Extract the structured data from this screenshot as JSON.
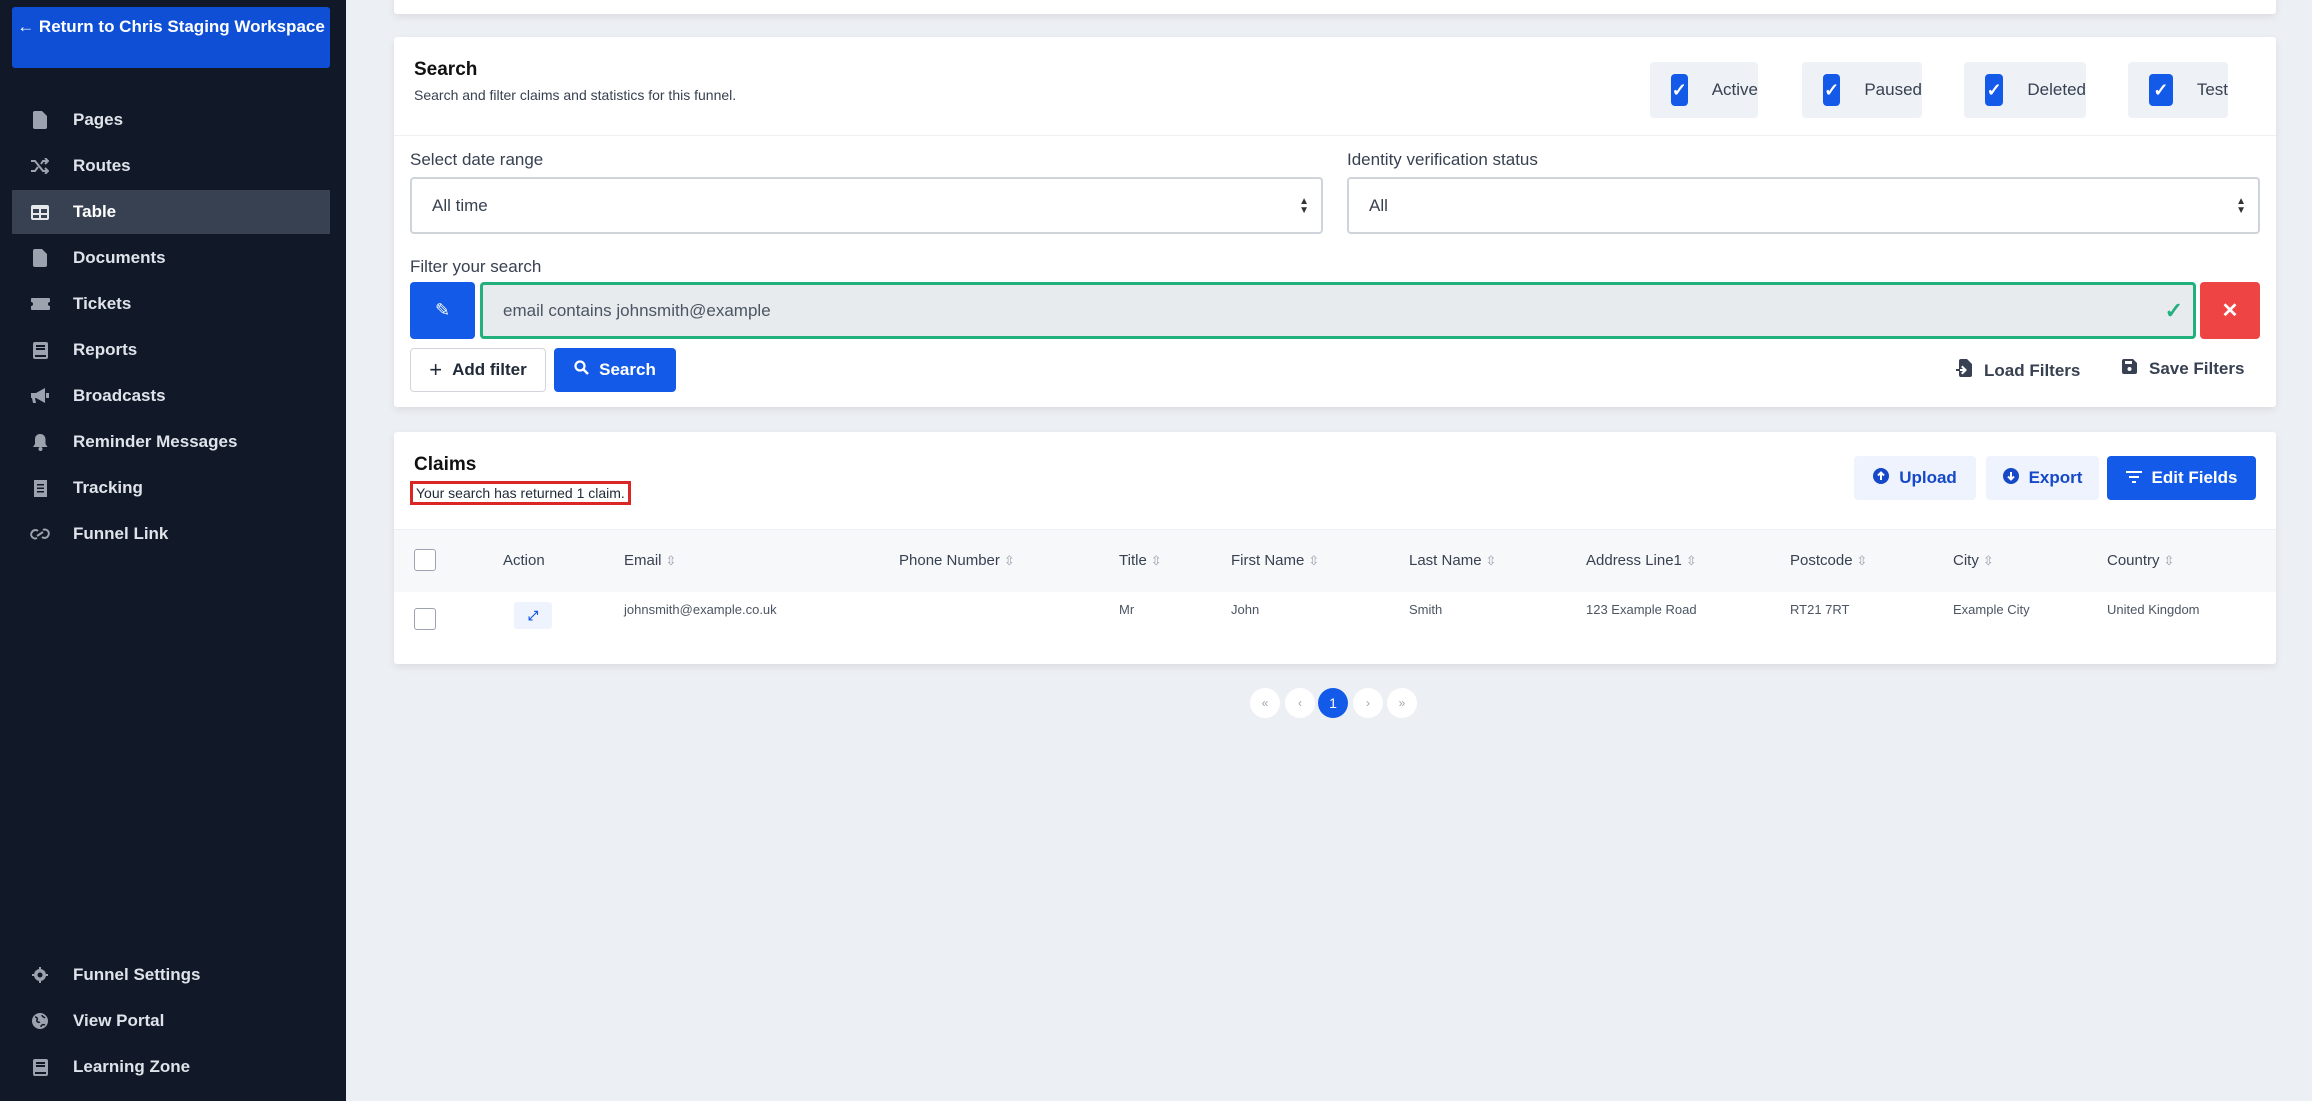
{
  "sidebar": {
    "return_label": "← Return to Chris Staging Workspace",
    "items": [
      {
        "label": "Pages",
        "icon": "file-icon"
      },
      {
        "label": "Routes",
        "icon": "shuffle-icon"
      },
      {
        "label": "Table",
        "icon": "table-icon",
        "active": true
      },
      {
        "label": "Documents",
        "icon": "file-icon"
      },
      {
        "label": "Tickets",
        "icon": "ticket-icon"
      },
      {
        "label": "Reports",
        "icon": "book-icon"
      },
      {
        "label": "Broadcasts",
        "icon": "megaphone-icon"
      },
      {
        "label": "Reminder Messages",
        "icon": "bell-icon"
      },
      {
        "label": "Tracking",
        "icon": "receipt-icon"
      },
      {
        "label": "Funnel Link",
        "icon": "link-icon"
      }
    ],
    "bottom_items": [
      {
        "label": "Funnel Settings",
        "icon": "gear-icon"
      },
      {
        "label": "View Portal",
        "icon": "globe-icon"
      },
      {
        "label": "Learning Zone",
        "icon": "book-icon"
      }
    ]
  },
  "search": {
    "title": "Search",
    "subtitle": "Search and filter claims and statistics for this funnel.",
    "status_filters": [
      {
        "label": "Active",
        "checked": true
      },
      {
        "label": "Paused",
        "checked": true
      },
      {
        "label": "Deleted",
        "checked": true
      },
      {
        "label": "Test",
        "checked": true
      }
    ],
    "date_range_label": "Select date range",
    "date_range_value": "All time",
    "idv_label": "Identity verification status",
    "idv_value": "All",
    "filter_label": "Filter your search",
    "filter_value": "email contains johnsmith@example",
    "add_filter_label": "Add filter",
    "search_label": "Search",
    "load_filters_label": "Load Filters",
    "save_filters_label": "Save Filters"
  },
  "claims": {
    "title": "Claims",
    "result_note": "Your search has returned 1 claim.",
    "upload_label": "Upload",
    "export_label": "Export",
    "edit_fields_label": "Edit Fields",
    "columns": [
      "Action",
      "Email",
      "Phone Number",
      "Title",
      "First Name",
      "Last Name",
      "Address Line1",
      "Postcode",
      "City",
      "Country"
    ],
    "rows": [
      {
        "email": "johnsmith@example.co.uk",
        "phone": "",
        "title": "Mr",
        "first_name": "John",
        "last_name": "Smith",
        "address1": "123 Example Road",
        "postcode": "RT21 7RT",
        "city": "Example City",
        "country": "United Kingdom"
      }
    ]
  },
  "pagination": {
    "first": "«",
    "prev": "‹",
    "current": "1",
    "next": "›",
    "last": "»"
  },
  "colors": {
    "primary": "#145ae8",
    "sidebar_bg": "#111827",
    "success": "#22b07d",
    "danger": "#ef4444"
  }
}
